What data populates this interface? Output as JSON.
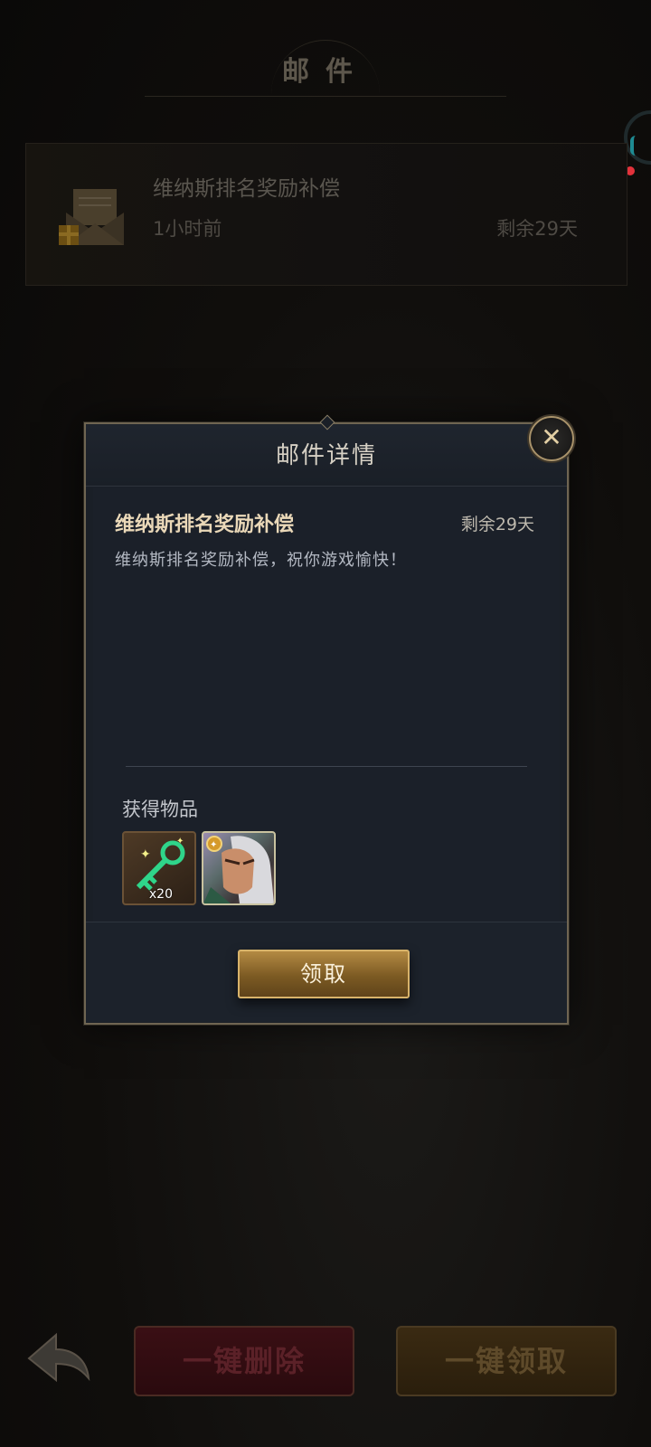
{
  "header": {
    "title": "邮件"
  },
  "mail_list": [
    {
      "title": "维纳斯排名奖励补偿",
      "time": "1小时前",
      "remaining": "剩余29天"
    }
  ],
  "bottom_bar": {
    "delete_all": "一键删除",
    "claim_all": "一键领取"
  },
  "modal": {
    "title": "邮件详情",
    "mail_title": "维纳斯排名奖励补偿",
    "remaining": "剩余29天",
    "content": "维纳斯排名奖励补偿，祝你游戏愉快！",
    "items_label": "获得物品",
    "items": [
      {
        "icon": "green-key-icon",
        "quantity": "x20"
      },
      {
        "icon": "hero-portrait-icon",
        "quantity": ""
      }
    ],
    "claim_button": "领取",
    "close_icon": "close-icon"
  },
  "colors": {
    "accent_gold": "#d8b36a",
    "notification_red": "#e2323b",
    "teal_ring": "#1e8b92"
  }
}
